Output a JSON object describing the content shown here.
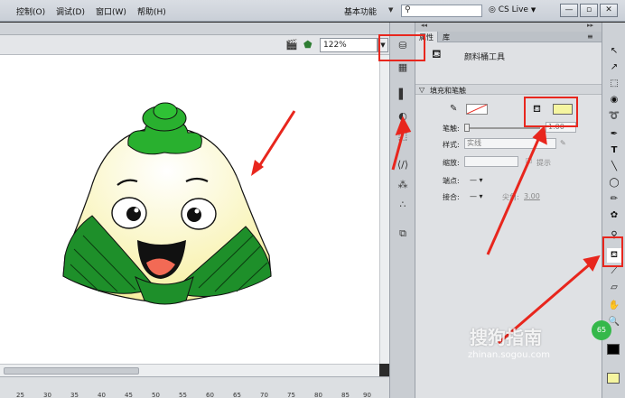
{
  "menu": {
    "items": [
      "调试(D)",
      "窗口(W)",
      "帮助(H)"
    ],
    "control": "控制(O)",
    "workspace": "基本功能",
    "cslive": "CS Live"
  },
  "window_buttons": [
    "—",
    "▫",
    "✕"
  ],
  "stage": {
    "zoom": "122%"
  },
  "properties": {
    "tabs": [
      "属性",
      "库"
    ],
    "tool_name": "颜料桶工具",
    "section": "填充和笔触",
    "stroke_label": "笔触:",
    "stroke_value": "1.00",
    "style_label": "样式:",
    "style_value": "实线",
    "scale_label": "缩放:",
    "hint_label": "提示",
    "cap_label": "端点:",
    "join_label": "接合:",
    "miter_label": "尖角:",
    "miter_value": "3.00",
    "fill_color": "#f5f5a0"
  },
  "timeline": {
    "ticks": [
      "25",
      "30",
      "35",
      "40",
      "45",
      "50",
      "55",
      "60",
      "65",
      "70",
      "75",
      "80",
      "85",
      "90"
    ]
  },
  "watermark": {
    "text": "搜狗指南",
    "url": "zhinan.sogou.com"
  },
  "badge": "65",
  "annotation_color": "#e8261d"
}
